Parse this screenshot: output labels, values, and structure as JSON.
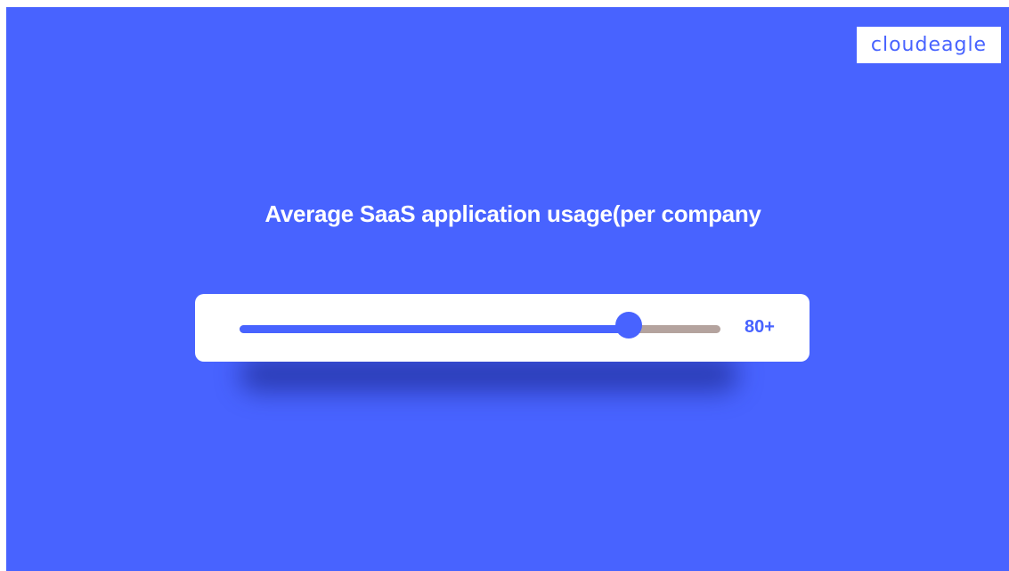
{
  "logo": {
    "text": "cloudeagle"
  },
  "title": "Average SaaS application usage(per company",
  "slider": {
    "fraction": 0.81,
    "value_label": "80+"
  },
  "colors": {
    "background": "#4863FF",
    "accent": "#4863FF",
    "track_remaining": "#B4A39E",
    "card": "#FFFFFF"
  }
}
